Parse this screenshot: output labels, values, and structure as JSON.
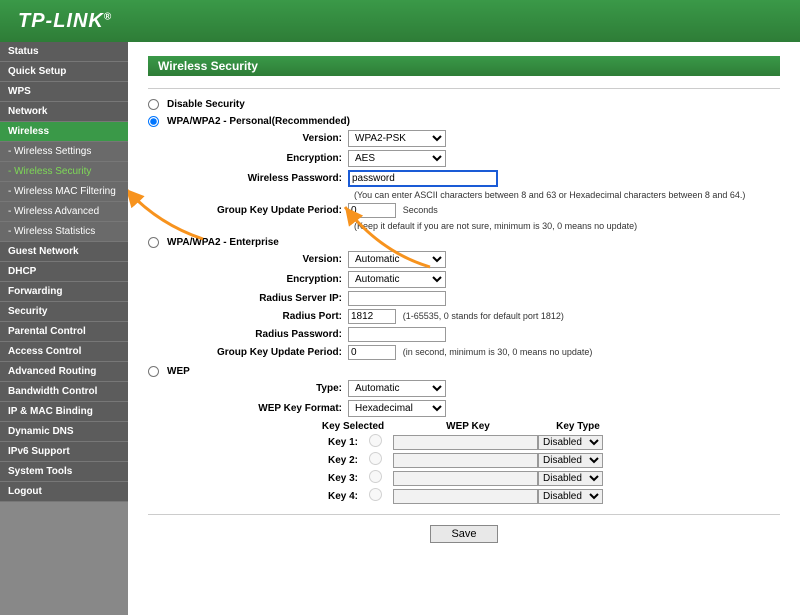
{
  "logo": "TP-LINK",
  "sidebar": [
    {
      "label": "Status",
      "type": "top"
    },
    {
      "label": "Quick Setup",
      "type": "top"
    },
    {
      "label": "WPS",
      "type": "top"
    },
    {
      "label": "Network",
      "type": "top"
    },
    {
      "label": "Wireless",
      "type": "active"
    },
    {
      "label": "- Wireless Settings",
      "type": "sub"
    },
    {
      "label": "- Wireless Security",
      "type": "sub-current"
    },
    {
      "label": "- Wireless MAC Filtering",
      "type": "sub"
    },
    {
      "label": "- Wireless Advanced",
      "type": "sub"
    },
    {
      "label": "- Wireless Statistics",
      "type": "sub"
    },
    {
      "label": "Guest Network",
      "type": "top"
    },
    {
      "label": "DHCP",
      "type": "top"
    },
    {
      "label": "Forwarding",
      "type": "top"
    },
    {
      "label": "Security",
      "type": "top"
    },
    {
      "label": "Parental Control",
      "type": "top"
    },
    {
      "label": "Access Control",
      "type": "top"
    },
    {
      "label": "Advanced Routing",
      "type": "top"
    },
    {
      "label": "Bandwidth Control",
      "type": "top"
    },
    {
      "label": "IP & MAC Binding",
      "type": "top"
    },
    {
      "label": "Dynamic DNS",
      "type": "top"
    },
    {
      "label": "IPv6 Support",
      "type": "top"
    },
    {
      "label": "System Tools",
      "type": "top"
    },
    {
      "label": "Logout",
      "type": "top"
    }
  ],
  "page_title": "Wireless Security",
  "disable_security": "Disable Security",
  "personal": {
    "title": "WPA/WPA2 - Personal(Recommended)",
    "version_label": "Version:",
    "version_value": "WPA2-PSK",
    "encryption_label": "Encryption:",
    "encryption_value": "AES",
    "password_label": "Wireless Password:",
    "password_value": "password",
    "password_hint": "(You can enter ASCII characters between 8 and 63 or Hexadecimal characters between 8 and 64.)",
    "gkup_label": "Group Key Update Period:",
    "gkup_value": "0",
    "gkup_unit": "Seconds",
    "gkup_hint": "(Keep it default if you are not sure, minimum is 30, 0 means no update)"
  },
  "enterprise": {
    "title": "WPA/WPA2 - Enterprise",
    "version_label": "Version:",
    "version_value": "Automatic",
    "encryption_label": "Encryption:",
    "encryption_value": "Automatic",
    "radius_ip_label": "Radius Server IP:",
    "radius_ip_value": "",
    "radius_port_label": "Radius Port:",
    "radius_port_value": "1812",
    "radius_port_hint": "(1-65535, 0 stands for default port 1812)",
    "radius_pw_label": "Radius Password:",
    "radius_pw_value": "",
    "gkup_label": "Group Key Update Period:",
    "gkup_value": "0",
    "gkup_hint": "(in second, minimum is 30, 0 means no update)"
  },
  "wep": {
    "title": "WEP",
    "type_label": "Type:",
    "type_value": "Automatic",
    "format_label": "WEP Key Format:",
    "format_value": "Hexadecimal",
    "head_selected": "Key Selected",
    "head_key": "WEP Key",
    "head_type": "Key Type",
    "keys": [
      {
        "label": "Key 1:",
        "type": "Disabled"
      },
      {
        "label": "Key 2:",
        "type": "Disabled"
      },
      {
        "label": "Key 3:",
        "type": "Disabled"
      },
      {
        "label": "Key 4:",
        "type": "Disabled"
      }
    ]
  },
  "save": "Save"
}
